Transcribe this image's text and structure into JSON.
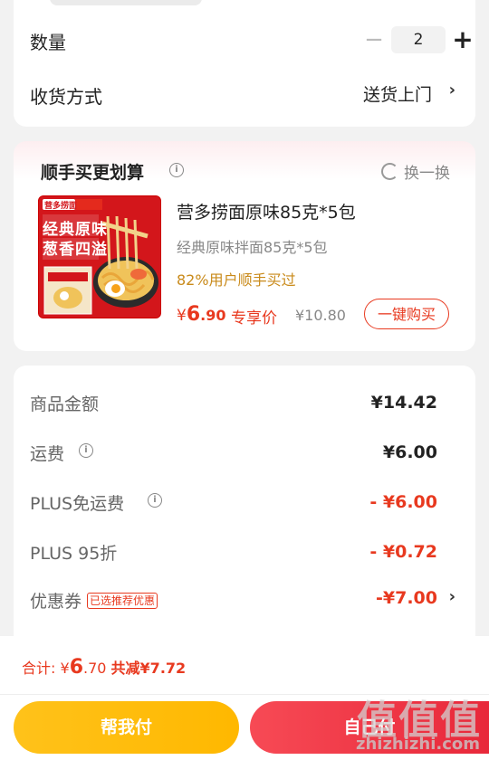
{
  "quantity": {
    "label": "数量",
    "minus": "−",
    "value": "2",
    "plus": "+"
  },
  "delivery": {
    "label": "收货方式",
    "value": "送货上门",
    "chevron": "›"
  },
  "bundle": {
    "title": "顺手买更划算",
    "info_icon": "i",
    "refresh_label": "换一换",
    "product": {
      "image_brand": "营多捞面",
      "image_slogan_1": "经典原味",
      "image_slogan_2": "葱香四溢",
      "name": "营多捞面原味85克*5包",
      "subtitle": "经典原味拌面85克*5包",
      "social_proof": "82%用户顺手买过",
      "price_symbol": "¥",
      "price_int": "6",
      "price_dec": ".90",
      "exclusive_label": "专享价",
      "original_price": "¥10.80",
      "buy_button": "一键购买"
    }
  },
  "details": {
    "rows": [
      {
        "label": "商品金额",
        "value": "¥14.42"
      },
      {
        "label": "运费",
        "value": "¥6.00"
      },
      {
        "label": "PLUS免运费",
        "value": "- ¥6.00"
      },
      {
        "label": "PLUS 95折",
        "value": "- ¥0.72"
      },
      {
        "label": "优惠券",
        "tag": "已选推荐优惠",
        "value": "-¥7.00"
      }
    ],
    "chevron": "›",
    "info_icon": "i"
  },
  "bottom": {
    "total_label": "合计:",
    "total_symbol": "¥",
    "total_int": "6",
    "total_dec": ".70",
    "saved": "共减¥7.72",
    "help_button": "帮我付",
    "self_button": "自己付"
  },
  "watermark": {
    "main": "值值值",
    "sub": "zhizhizhi.com"
  },
  "colors": {
    "accent": "#e8391f",
    "gold": "#ffb800",
    "pay": "#e8283a"
  }
}
